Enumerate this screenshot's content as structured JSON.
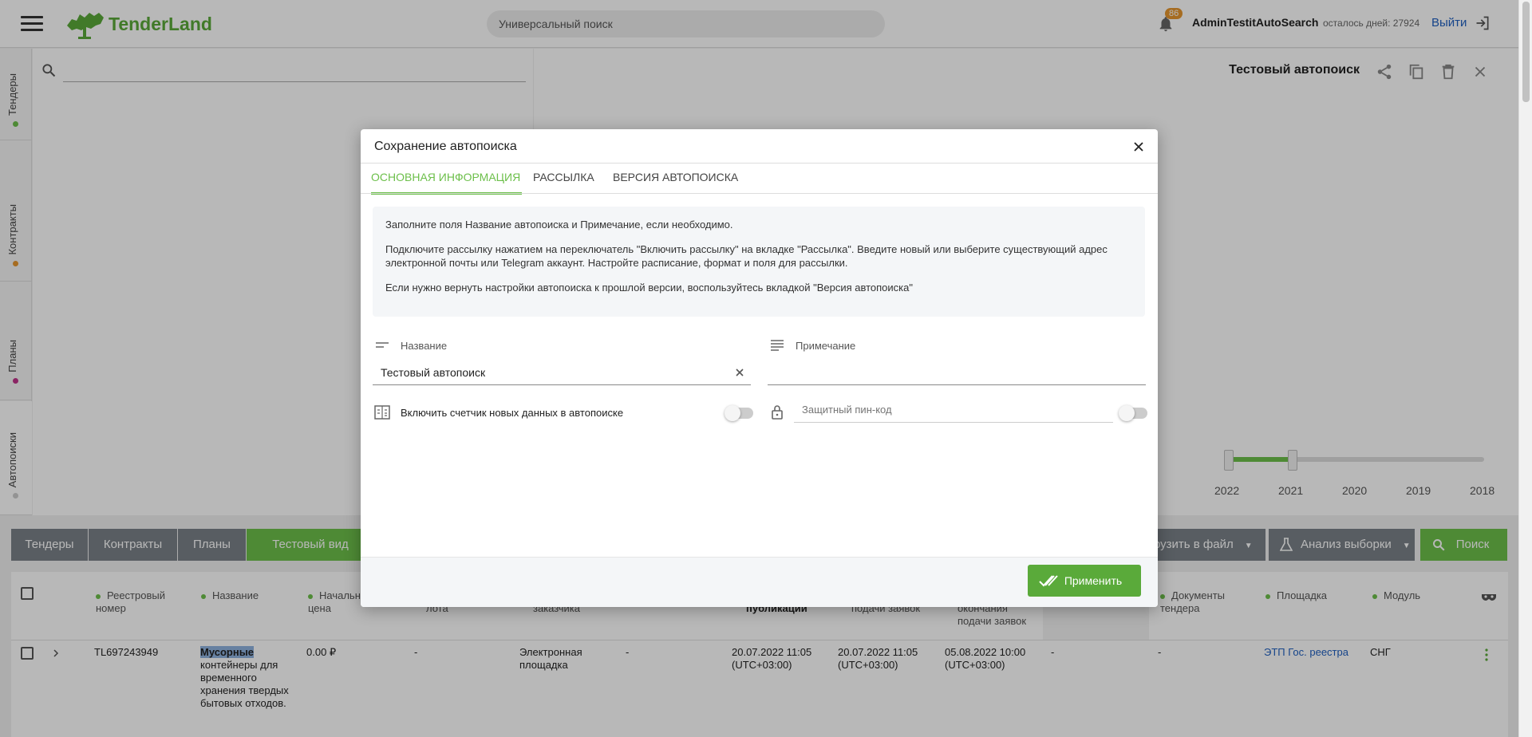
{
  "header": {
    "logo_text": "TenderLand",
    "search_placeholder": "Универсальный поиск",
    "notification_count": "86",
    "username": "AdminTestitAutoSearch",
    "days_left": "осталось дней: 27924",
    "logout_label": "Выйти"
  },
  "vertical_tabs": [
    {
      "label": "Тендеры",
      "dot_color": "#6cbf4a"
    },
    {
      "label": "Контракты",
      "dot_color": "#e6962e"
    },
    {
      "label": "Планы",
      "dot_color": "#c0328a"
    },
    {
      "label": "Автопоиски",
      "dot_color": "#cccccc"
    }
  ],
  "right_panel": {
    "title": "Тестовый автопоиск",
    "years": [
      "2022",
      "2021",
      "2020",
      "2019",
      "2018"
    ]
  },
  "toolbar": {
    "tabs": [
      "Тендеры",
      "Контракты",
      "Планы",
      "Тестовый вид"
    ],
    "export_label": "рузить в файл",
    "analysis_label": "Анализ выборки",
    "search_label": "Поиск"
  },
  "table": {
    "headers": {
      "reg_number": "Реестровый номер",
      "name": "Название",
      "price": "Начальн цена",
      "lot": "лота",
      "customer": "заказчика",
      "publication": "публикации",
      "apply": "подачи заявок",
      "end": "окончания подачи заявок",
      "docs": "Документы тендера",
      "platform": "Площадка",
      "module": "Модуль"
    },
    "row": {
      "reg_number": "TL697243949",
      "name_highlight": "Мусорные",
      "name_rest": "контейнеры для временного хранения твердых бытовых отходов.",
      "price": "0.00 ₽",
      "lot": "-",
      "customer": "Электронная площадка",
      "col5": "-",
      "publication": "20.07.2022 11:05 (UTC+03:00)",
      "apply": "20.07.2022 11:05 (UTC+03:00)",
      "end": "05.08.2022 10:00 (UTC+03:00)",
      "col9": "-",
      "docs": "-",
      "platform": "ЭТП Гос. реестра",
      "module": "СНГ"
    }
  },
  "modal": {
    "title": "Сохранение автопоиска",
    "tabs": [
      "Основная информация",
      "Рассылка",
      "Версия автопоиска"
    ],
    "active_tab": 0,
    "info": [
      "Заполните поля Название автопоиска и Примечание, если необходимо.",
      "Подключите рассылку нажатием на переключатель \"Включить рассылку\" на вкладке \"Рассылка\". Введите новый или выберите существующий адрес электронной почты или Telegram аккаунт. Настройте расписание, формат и поля для рассылки.",
      "Если нужно вернуть настройки автопоиска к прошлой версии, воспользуйтесь вкладкой \"Версия автопоиска\""
    ],
    "name_label": "Название",
    "name_value": "Тестовый автопоиск",
    "note_label": "Примечание",
    "note_value": "",
    "counter_label": "Включить счетчик новых данных в автопоиске",
    "counter_enabled": false,
    "pin_placeholder": "Защитный пин-код",
    "pin_enabled": false,
    "apply_label": "Применить"
  },
  "colors": {
    "accent_green": "#6cbf4a",
    "link_blue": "#2060c0",
    "badge_orange": "#e6962e"
  }
}
